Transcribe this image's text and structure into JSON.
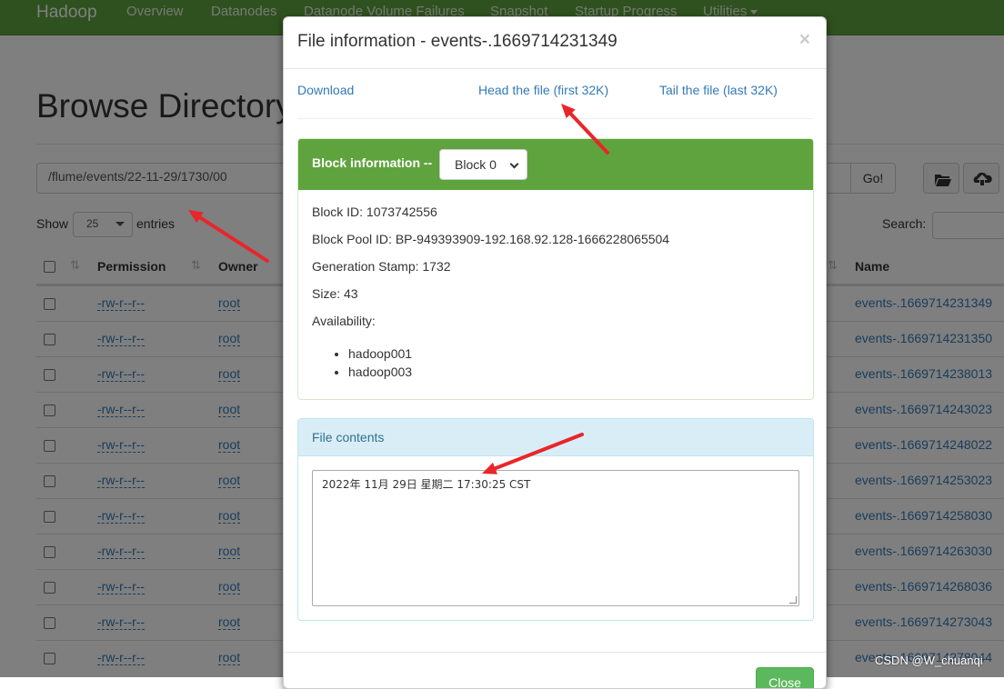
{
  "navbar": {
    "brand": "Hadoop",
    "items": [
      "Overview",
      "Datanodes",
      "Datanode Volume Failures",
      "Snapshot",
      "Startup Progress",
      "Utilities"
    ]
  },
  "page": {
    "title": "Browse Directory",
    "path_value": "/flume/events/22-11-29/1730/00",
    "go_label": "Go!",
    "show_label": "Show",
    "entries_value": "25",
    "entries_label": "entries",
    "search_label": "Search:"
  },
  "table": {
    "headers": [
      "Permission",
      "Owner",
      "Name"
    ],
    "rows": [
      {
        "permission": "-rw-r--r--",
        "owner": "root",
        "name": "events-.1669714231349"
      },
      {
        "permission": "-rw-r--r--",
        "owner": "root",
        "name": "events-.1669714231350"
      },
      {
        "permission": "-rw-r--r--",
        "owner": "root",
        "name": "events-.1669714238013"
      },
      {
        "permission": "-rw-r--r--",
        "owner": "root",
        "name": "events-.1669714243023"
      },
      {
        "permission": "-rw-r--r--",
        "owner": "root",
        "name": "events-.1669714248022"
      },
      {
        "permission": "-rw-r--r--",
        "owner": "root",
        "name": "events-.1669714253023"
      },
      {
        "permission": "-rw-r--r--",
        "owner": "root",
        "name": "events-.1669714258030"
      },
      {
        "permission": "-rw-r--r--",
        "owner": "root",
        "name": "events-.1669714263030"
      },
      {
        "permission": "-rw-r--r--",
        "owner": "root",
        "name": "events-.1669714268036"
      },
      {
        "permission": "-rw-r--r--",
        "owner": "root",
        "name": "events-.1669714273043"
      },
      {
        "permission": "-rw-r--r--",
        "owner": "root",
        "name": "events-.1669714278044"
      }
    ]
  },
  "modal": {
    "title": "File information - events-.1669714231349",
    "close_symbol": "×",
    "download_label": "Download",
    "head_label": "Head the file (first 32K)",
    "tail_label": "Tail the file (last 32K)",
    "block_title": "Block information --",
    "block_select": "Block 0",
    "block_id": "Block ID: 1073742556",
    "block_pool_id": "Block Pool ID: BP-949393909-192.168.92.128-1666228065504",
    "generation_stamp": "Generation Stamp: 1732",
    "size": "Size: 43",
    "availability": "Availability:",
    "hosts": [
      "hadoop001",
      "hadoop003"
    ],
    "contents_title": "File contents",
    "contents_text": "2022年 11月 29日 星期二 17:30:25 CST",
    "close_button": "Close"
  },
  "annotation": {
    "arrow_color": "#e8262a"
  },
  "watermark": "CSDN @W_chuanqi"
}
